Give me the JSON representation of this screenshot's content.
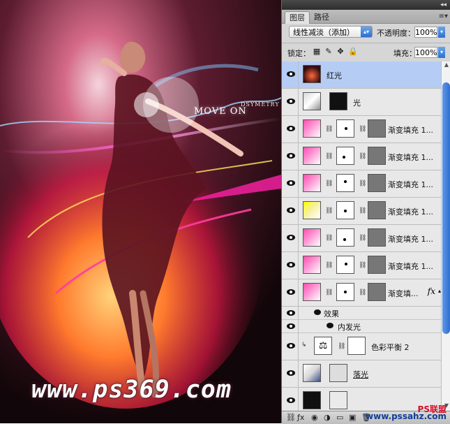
{
  "artwork": {
    "title": "MOVE ON",
    "subtitle": "DSYMETRY",
    "watermark": "www.ps369.com"
  },
  "panel": {
    "tabs": [
      {
        "label": "图层"
      },
      {
        "label": "路径"
      }
    ],
    "blend_mode": "线性减淡（添加）",
    "opacity_label": "不透明度：",
    "opacity_value": "100%",
    "lock_label": "锁定：",
    "fill_label": "填充：",
    "fill_value": "100%",
    "layers": [
      {
        "name": "红光",
        "selected": true
      },
      {
        "name": "光"
      },
      {
        "name": "渐变填充 1..."
      },
      {
        "name": "渐变填充 1..."
      },
      {
        "name": "渐变填充 1..."
      },
      {
        "name": "渐变填充 1..."
      },
      {
        "name": "渐变填充 1..."
      },
      {
        "name": "渐变填充 1..."
      },
      {
        "name": "渐变填...",
        "has_fx": true
      }
    ],
    "effects_label": "效果",
    "inner_glow_label": "内发光",
    "color_balance": "色彩平衡 2",
    "glow_layer": "落光",
    "bottom_texts": {
      "site_a": "PS联盟",
      "site_b": "www.pssahz.com"
    }
  },
  "colors": {
    "selected_row": "#b5cdf5",
    "scroll_accent": "#2f6fd0"
  }
}
